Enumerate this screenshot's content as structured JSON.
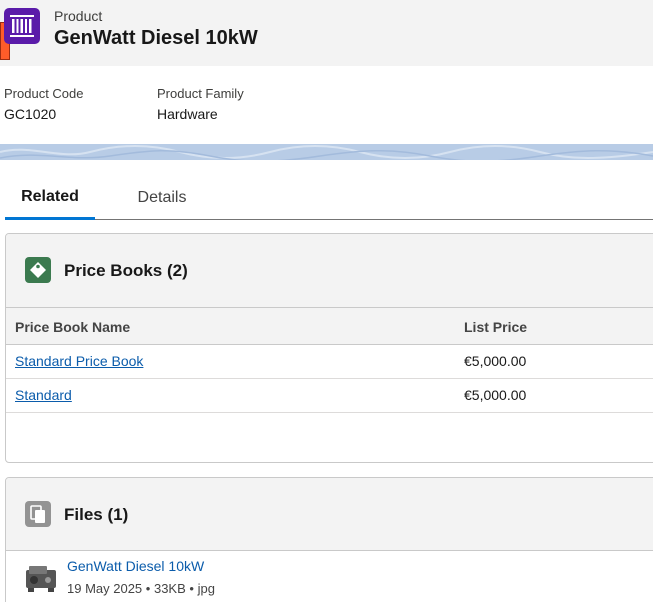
{
  "header": {
    "object_type": "Product",
    "title": "GenWatt Diesel 10kW",
    "icon": "product-barcode-icon",
    "icon_color": "#5a1ba9",
    "edge_color": "#fe5c29"
  },
  "highlights": {
    "fields": [
      {
        "label": "Product Code",
        "value": "GC1020"
      },
      {
        "label": "Product Family",
        "value": "Hardware"
      }
    ]
  },
  "tabs": [
    {
      "label": "Related",
      "active": true
    },
    {
      "label": "Details",
      "active": false
    }
  ],
  "price_books": {
    "title": "Price Books (2)",
    "icon": "price-tag-icon",
    "icon_color": "#3b7a4f",
    "columns": [
      "Price Book Name",
      "List Price"
    ],
    "rows": [
      {
        "name": "Standard Price Book",
        "price": "€5,000.00"
      },
      {
        "name": "Standard",
        "price": "€5,000.00"
      }
    ]
  },
  "files": {
    "title": "Files (1)",
    "icon": "files-icon",
    "icon_color": "#939393",
    "items": [
      {
        "name": "GenWatt Diesel 10kW",
        "date": "19 May 2025",
        "size": "33KB",
        "ext": "jpg",
        "thumb": "generator-thumbnail"
      }
    ]
  },
  "colors": {
    "accent": "#0176d3",
    "link": "#0b5cab"
  }
}
